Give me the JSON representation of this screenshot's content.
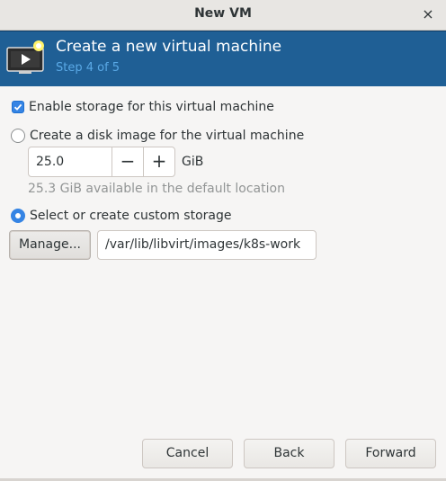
{
  "window": {
    "title": "New VM",
    "close_icon": "×"
  },
  "banner": {
    "heading": "Create a new virtual machine",
    "step": "Step 4 of 5",
    "icon": "vm-monitor-icon",
    "background": "#1f5f95",
    "step_color": "#5aa9e6"
  },
  "storage": {
    "enable_label": "Enable storage for this virtual machine",
    "enable_checked": true,
    "disk_image_label": "Create a disk image for the virtual machine",
    "disk_image_selected": false,
    "disk_size": "25.0",
    "decrement": "−",
    "increment": "+",
    "unit": "GiB",
    "available_hint": "25.3 GiB available in the default location",
    "custom_label": "Select or create custom storage",
    "custom_selected": true,
    "manage_label": "Manage...",
    "path_value": "/var/lib/libvirt/images/k8s-work"
  },
  "footer": {
    "cancel_label": "Cancel",
    "back_label": "Back",
    "forward_label": "Forward"
  },
  "colors": {
    "accent": "#3584e4"
  }
}
